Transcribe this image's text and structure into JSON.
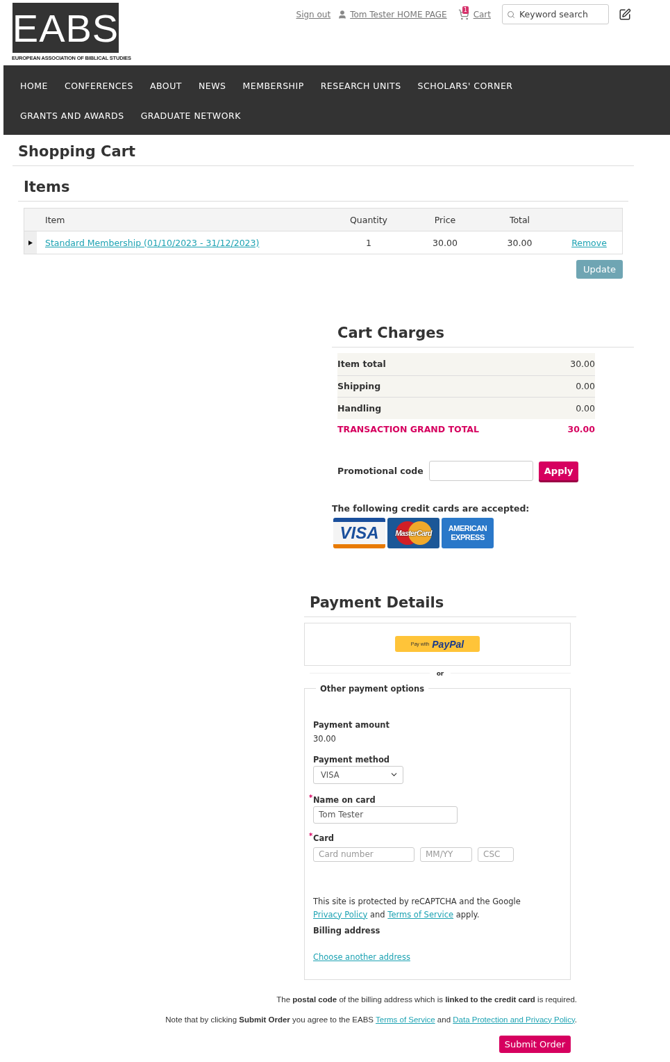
{
  "logo": {
    "mark": "EABS",
    "subtitle": "EUROPEAN ASSOCIATION OF BIBLICAL STUDIES"
  },
  "top_links": {
    "sign_out": "Sign out",
    "profile": "Tom Tester HOME PAGE",
    "cart": "Cart",
    "cart_count": "1",
    "search_placeholder": "Keyword search"
  },
  "nav": [
    [
      "HOME",
      "CONFERENCES",
      "ABOUT",
      "NEWS",
      "MEMBERSHIP",
      "RESEARCH UNITS",
      "SCHOLARS' CORNER"
    ],
    [
      "GRANTS AND AWARDS",
      "GRADUATE NETWORK"
    ]
  ],
  "page_title": "Shopping Cart",
  "items": {
    "heading": "Items",
    "columns": [
      "Item",
      "Quantity",
      "Price",
      "Total"
    ],
    "rows": [
      {
        "item": "Standard Membership (01/10/2023 - 31/12/2023)",
        "quantity": "1",
        "price": "30.00",
        "total": "30.00",
        "action": "Remove",
        "expanded": false
      }
    ],
    "update_button": "Update"
  },
  "cart_charges": {
    "heading": "Cart Charges",
    "rows": [
      {
        "label": "Item total",
        "value": "30.00",
        "kind": "line"
      },
      {
        "label": "Shipping",
        "value": "0.00",
        "kind": "line"
      },
      {
        "label": "Handling",
        "value": "0.00",
        "kind": "line"
      },
      {
        "label": "TRANSACTION GRAND TOTAL",
        "value": "30.00",
        "kind": "grand"
      }
    ],
    "promo_label": "Promotional code",
    "apply_button": "Apply",
    "cards_note": "The following credit cards are accepted:",
    "cards": [
      {
        "label": "VISA",
        "kind": "visa",
        "color": "#1a4f9c"
      },
      {
        "label": "MasterCard",
        "kind": "mastercard",
        "color": "#1b5797"
      },
      {
        "label": "AMERICAN EXPRESS",
        "kind": "amex",
        "color": "#2a78c9"
      }
    ]
  },
  "payment": {
    "heading": "Payment Details",
    "paypal": {
      "prefix": "Pay with",
      "brand": "PayPal"
    },
    "separator": "or",
    "legend": "Other payment options",
    "amount_label": "Payment amount",
    "amount": "30.00",
    "method_label": "Payment method",
    "method": "VISA",
    "required_mark": "*",
    "name_label": "Name on card",
    "name_value": "Tom Tester",
    "name_required": true,
    "card_label": "Card",
    "card_required": true,
    "card_fields": [
      {
        "placeholder": "Card number",
        "kind": "number"
      },
      {
        "placeholder": "MM/YY",
        "kind": "expiry"
      },
      {
        "placeholder": "CSC",
        "kind": "csc"
      }
    ],
    "recaptcha": [
      {
        "text": "This site is protected by reCAPTCHA and the Google ",
        "link": false
      },
      {
        "text": "Privacy Policy",
        "link": true
      },
      {
        "text": " and ",
        "link": false
      },
      {
        "text": "Terms of Service",
        "link": true
      },
      {
        "text": " apply.",
        "link": false
      }
    ],
    "billing_label": "Billing address",
    "billing_link": "Choose another address"
  },
  "notes": [
    [
      {
        "text": "The **postal code** of the billing address which is **linked to the credit card** is required.",
        "link": false
      }
    ],
    [
      {
        "text": "Note that by clicking **Submit Order** you agree to the EABS ",
        "link": false
      },
      {
        "text": "Terms of Service",
        "link": true
      },
      {
        "text": " and ",
        "link": false
      },
      {
        "text": "Data Protection and Privacy Policy",
        "link": true
      },
      {
        "text": ".",
        "link": false
      }
    ]
  ],
  "submit_button": "Submit Order"
}
